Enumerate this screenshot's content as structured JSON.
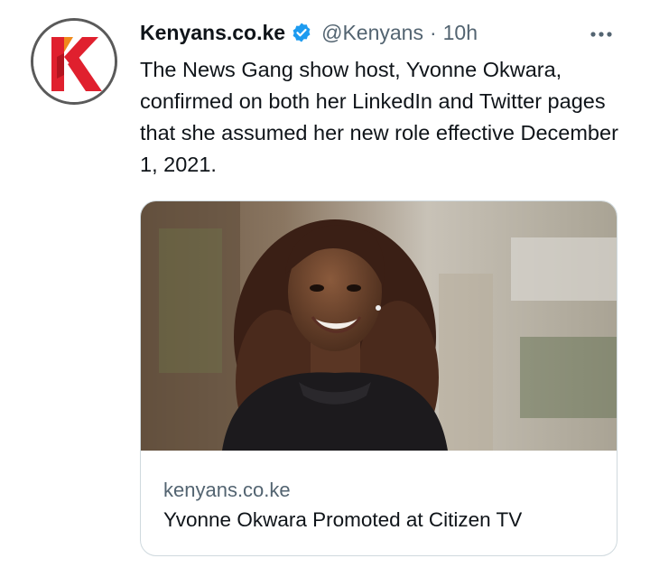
{
  "tweet": {
    "author_name": "Kenyans.co.ke",
    "handle": "@Kenyans",
    "separator": "·",
    "time": "10h",
    "text": "The News Gang show host, Yvonne Okwara, confirmed on both her LinkedIn and Twitter pages that she assumed her new role effective December 1, 2021.",
    "card": {
      "domain": "kenyans.co.ke",
      "title": "Yvonne Okwara Promoted at Citizen TV"
    }
  },
  "icons": {
    "verified": "verified-badge-icon",
    "more": "more-options-icon",
    "logo": "kenyans-logo"
  },
  "colors": {
    "brand_red": "#e0202e",
    "brand_orange": "#f08a1c",
    "verified_blue": "#1d9bf0",
    "secondary_text": "#536471",
    "border": "#cfd9de"
  }
}
